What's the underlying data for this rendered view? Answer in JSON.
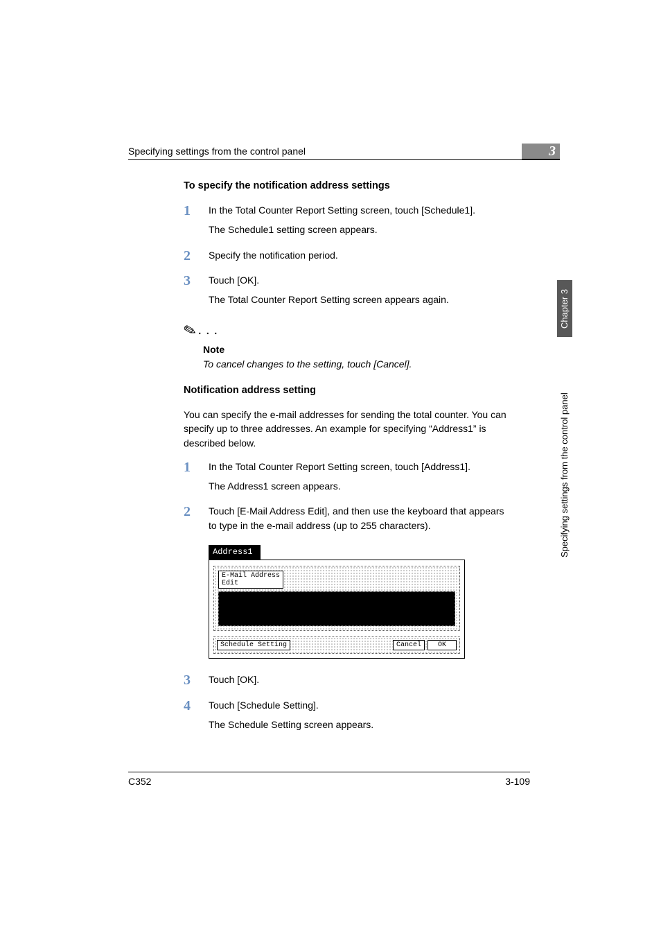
{
  "running_header": "Specifying settings from the control panel",
  "chapter_number": "3",
  "side_chapter": "Chapter 3",
  "side_text": "Specifying settings from the control panel",
  "section1": {
    "heading": "To specify the notification address settings",
    "steps": [
      {
        "num": "1",
        "lines": [
          "In the Total Counter Report Setting screen, touch [Schedule1].",
          "The Schedule1 setting screen appears."
        ]
      },
      {
        "num": "2",
        "lines": [
          "Specify the notification period."
        ]
      },
      {
        "num": "3",
        "lines": [
          "Touch [OK].",
          "The Total Counter Report Setting screen appears again."
        ]
      }
    ]
  },
  "note": {
    "label": "Note",
    "text": "To cancel changes to the setting, touch [Cancel]."
  },
  "section2": {
    "heading": "Notification address setting",
    "intro": "You can specify the e-mail addresses for sending the total counter. You can specify up to three addresses. An example for specifying “Address1” is described below.",
    "steps_a": [
      {
        "num": "1",
        "lines": [
          "In the Total Counter Report Setting screen, touch [Address1].",
          "The Address1 screen appears."
        ]
      },
      {
        "num": "2",
        "lines": [
          "Touch [E-Mail Address Edit], and then use the keyboard that appears to type in the e-mail address (up to 255 characters)."
        ]
      }
    ],
    "steps_b": [
      {
        "num": "3",
        "lines": [
          "Touch [OK]."
        ]
      },
      {
        "num": "4",
        "lines": [
          "Touch [Schedule Setting].",
          "The Schedule Setting screen appears."
        ]
      }
    ]
  },
  "screenshot": {
    "title": "Address1",
    "email_btn": "E-Mail Address\nEdit",
    "schedule_btn": "Schedule Setting",
    "cancel_btn": "Cancel",
    "ok_btn": "OK"
  },
  "footer": {
    "left": "C352",
    "right": "3-109"
  }
}
